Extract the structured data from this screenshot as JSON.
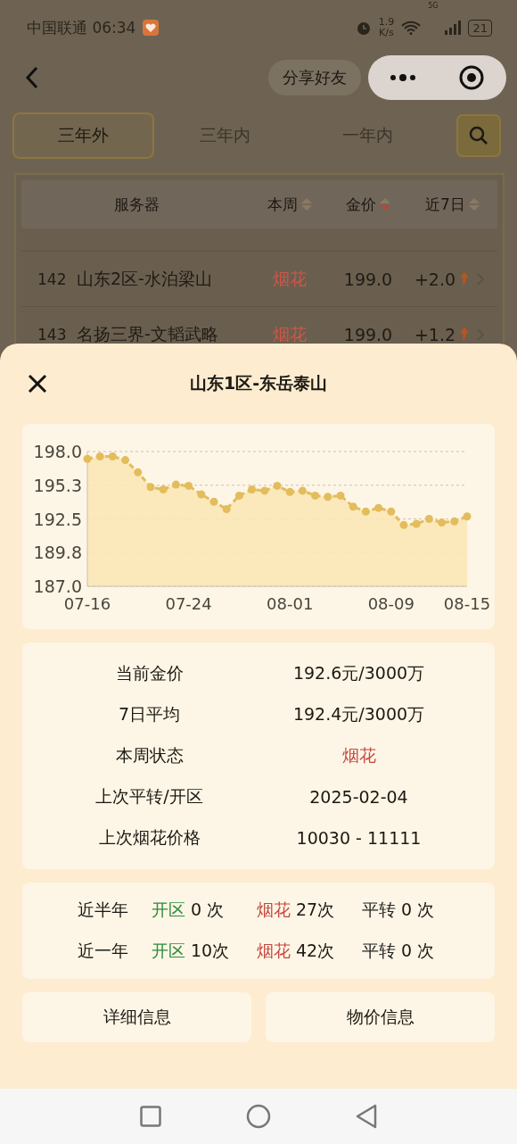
{
  "status_bar": {
    "carrier_time": "中国联通 06:34",
    "speed": "1.9",
    "speed_unit": "K/s",
    "network": "5G",
    "battery": "21"
  },
  "nav": {
    "share_button": "分享好友"
  },
  "tabs": [
    {
      "label": "三年外",
      "selected": true
    },
    {
      "label": "三年内",
      "selected": false
    },
    {
      "label": "一年内",
      "selected": false
    }
  ],
  "table": {
    "columns": [
      {
        "label": "服务器"
      },
      {
        "label": "本周",
        "sorted": false
      },
      {
        "label": "金价",
        "sorted": true
      },
      {
        "label": "近7日",
        "sorted": false
      }
    ],
    "rows": [
      {
        "rank": "142",
        "server": "山东2区-水泊梁山",
        "status": "烟花",
        "price": "199.0",
        "change": "+2.0"
      },
      {
        "rank": "143",
        "server": "名扬三界-文韬武略",
        "status": "烟花",
        "price": "199.0",
        "change": "+1.2"
      }
    ]
  },
  "sheet": {
    "title": "山东1区-东岳泰山",
    "chart_data": {
      "type": "area",
      "ylim": [
        187.0,
        198.0
      ],
      "yticks": [
        {
          "value": 198.0,
          "label": "198.0"
        },
        {
          "value": 195.25,
          "label": "195.3"
        },
        {
          "value": 192.5,
          "label": "192.5"
        },
        {
          "value": 189.75,
          "label": "189.8"
        },
        {
          "value": 187.0,
          "label": "187.0"
        }
      ],
      "categories": [
        "07-16",
        null,
        null,
        null,
        null,
        null,
        null,
        null,
        "07-24",
        null,
        null,
        null,
        null,
        null,
        null,
        null,
        "08-01",
        null,
        null,
        null,
        null,
        null,
        null,
        null,
        "08-09",
        null,
        null,
        null,
        null,
        null,
        "08-15"
      ],
      "series": [
        {
          "color": "#e3bc5c",
          "values": [
            197.4,
            197.6,
            197.6,
            197.3,
            196.3,
            195.1,
            194.9,
            195.3,
            195.2,
            194.5,
            193.9,
            193.3,
            194.4,
            194.9,
            194.8,
            195.2,
            194.7,
            194.8,
            194.4,
            194.3,
            194.4,
            193.5,
            193.1,
            193.4,
            193.1,
            192.0,
            192.1,
            192.5,
            192.2,
            192.3,
            192.7
          ]
        }
      ]
    },
    "info": [
      {
        "label": "当前金价",
        "value": "192.6元/3000万",
        "kind": "plain"
      },
      {
        "label": "7日平均",
        "value": "192.4元/3000万",
        "kind": "plain"
      },
      {
        "label": "本周状态",
        "value": "烟花",
        "kind": "status"
      },
      {
        "label": "上次平转/开区",
        "value": "2025-02-04",
        "kind": "plain"
      },
      {
        "label": "上次烟花价格",
        "value": "10030 - 11111",
        "kind": "plain"
      }
    ],
    "stats": [
      {
        "period": "近半年",
        "items": [
          {
            "kind": "open",
            "label": "开区",
            "count": "0 次"
          },
          {
            "kind": "firework",
            "label": "烟花",
            "count": "27次"
          },
          {
            "kind": "flat",
            "label": "平转",
            "count": "0 次"
          }
        ]
      },
      {
        "period": "近一年",
        "items": [
          {
            "kind": "open",
            "label": "开区",
            "count": "10次"
          },
          {
            "kind": "firework",
            "label": "烟花",
            "count": "42次"
          },
          {
            "kind": "flat",
            "label": "平转",
            "count": "0 次"
          }
        ]
      }
    ],
    "buttons": [
      "详细信息",
      "物价信息"
    ]
  }
}
